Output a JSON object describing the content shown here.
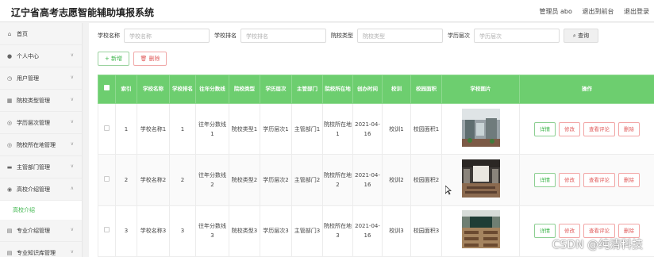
{
  "app_title": "辽宁省高考志愿智能辅助填报系统",
  "header": {
    "user": "管理员 abo",
    "backend": "退出到前台",
    "logout": "退出登录"
  },
  "sidebar": {
    "items": [
      {
        "label": "首页",
        "icon": "home-icon"
      },
      {
        "label": "个人中心",
        "icon": "user-icon"
      },
      {
        "label": "用户管理",
        "icon": "clock-icon"
      },
      {
        "label": "院校类型管理",
        "icon": "grid-icon"
      },
      {
        "label": "学历层次管理",
        "icon": "compass-icon"
      },
      {
        "label": "院校所在地管理",
        "icon": "compass-icon"
      },
      {
        "label": "主管部门管理",
        "icon": "card-icon"
      },
      {
        "label": "高校介绍管理",
        "icon": "location-icon"
      },
      {
        "label": "专业介绍管理",
        "icon": "document-icon"
      },
      {
        "label": "专业知识库管理",
        "icon": "document-icon"
      }
    ],
    "sub_item": "高校介绍"
  },
  "search": {
    "labels": [
      "学校名称",
      "学校排名",
      "院校类型",
      "学历层次"
    ],
    "placeholders": [
      "学校名称",
      "学校排名",
      "院校类型",
      "学历层次"
    ],
    "query_button": "查询"
  },
  "toolbar": {
    "add": "新增",
    "delete": "删除"
  },
  "table": {
    "columns": [
      "索引",
      "学校名称",
      "学校排名",
      "往年分数线",
      "院校类型",
      "学历层次",
      "主管部门",
      "院校所在地",
      "创办时间",
      "校训",
      "校园面积",
      "学校图片",
      "操作"
    ],
    "rows": [
      {
        "index": "1",
        "name": "学校名称1",
        "rank": "1",
        "score": "往年分数线1",
        "type": "院校类型1",
        "level": "学历层次1",
        "dept": "主管部门1",
        "loc": "院校所在地1",
        "date": "2021-04-16",
        "motto": "校训1",
        "area": "校园面积1"
      },
      {
        "index": "2",
        "name": "学校名称2",
        "rank": "2",
        "score": "往年分数线2",
        "type": "院校类型2",
        "level": "学历层次2",
        "dept": "主管部门2",
        "loc": "院校所在地2",
        "date": "2021-04-16",
        "motto": "校训2",
        "area": "校园面积2"
      },
      {
        "index": "3",
        "name": "学校名称3",
        "rank": "3",
        "score": "往年分数线3",
        "type": "院校类型3",
        "level": "学历层次3",
        "dept": "主管部门3",
        "loc": "院校所在地3",
        "date": "2021-04-16",
        "motto": "校训3",
        "area": "校园面积3"
      }
    ],
    "actions": {
      "detail": "详情",
      "edit": "修改",
      "comments": "查看评论",
      "delete": "删除"
    }
  },
  "watermark": "CSDN @纯清科技",
  "colors": {
    "accent": "#3bb54a",
    "header_bg": "#6dce6f",
    "danger": "#e05b5b"
  }
}
